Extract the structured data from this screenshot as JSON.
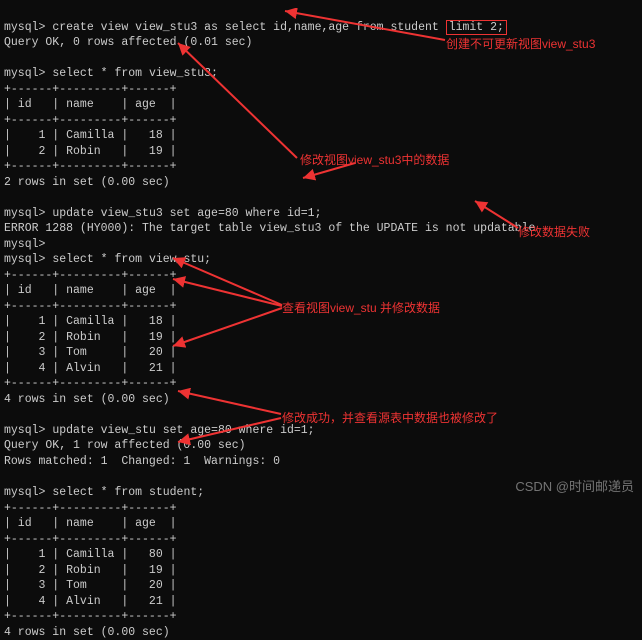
{
  "prompt": "mysql>",
  "commands": {
    "create_view": "create view view_stu3 as select id,name,age from student ",
    "create_view_boxed": "limit 2;",
    "select_stu3": "select * from view_stu3;",
    "update_stu3": "update view_stu3 set age=80 where id=1;",
    "select_stu": "select * from view_stu;",
    "update_stu": "update view_stu set age=80 where id=1;",
    "select_student": "select * from student;"
  },
  "responses": {
    "query_ok_create": "Query OK, 0 rows affected (0.01 sec)",
    "rows2": "2 rows in set (0.00 sec)",
    "error1288": "ERROR 1288 (HY000): The target table view_stu3 of the UPDATE is not updatable",
    "rows4": "4 rows in set (0.00 sec)",
    "query_ok_update": "Query OK, 1 row affected (0.00 sec)",
    "rows_matched": "Rows matched: 1  Changed: 1  Warnings: 0"
  },
  "table": {
    "sep": "+------+---------+------+",
    "header": "| id   | name    | age  |"
  },
  "rows_stu3": [
    "|    1 | Camilla |   18 |",
    "|    2 | Robin   |   19 |"
  ],
  "rows_stu": [
    "|    1 | Camilla |   18 |",
    "|    2 | Robin   |   19 |",
    "|    3 | Tom     |   20 |",
    "|    4 | Alvin   |   21 |"
  ],
  "rows_student": [
    "|    1 | Camilla |   80 |",
    "|    2 | Robin   |   19 |",
    "|    3 | Tom     |   20 |",
    "|    4 | Alvin   |   21 |"
  ],
  "annotations": {
    "a1": "创建不可更新视图view_stu3",
    "a2": "修改视图view_stu3中的数据",
    "a3": "修改数据失败",
    "a4": "查看视图view_stu 并修改数据",
    "a5": "修改成功，并查看源表中数据也被修改了"
  },
  "watermark": "CSDN @时间邮递员"
}
